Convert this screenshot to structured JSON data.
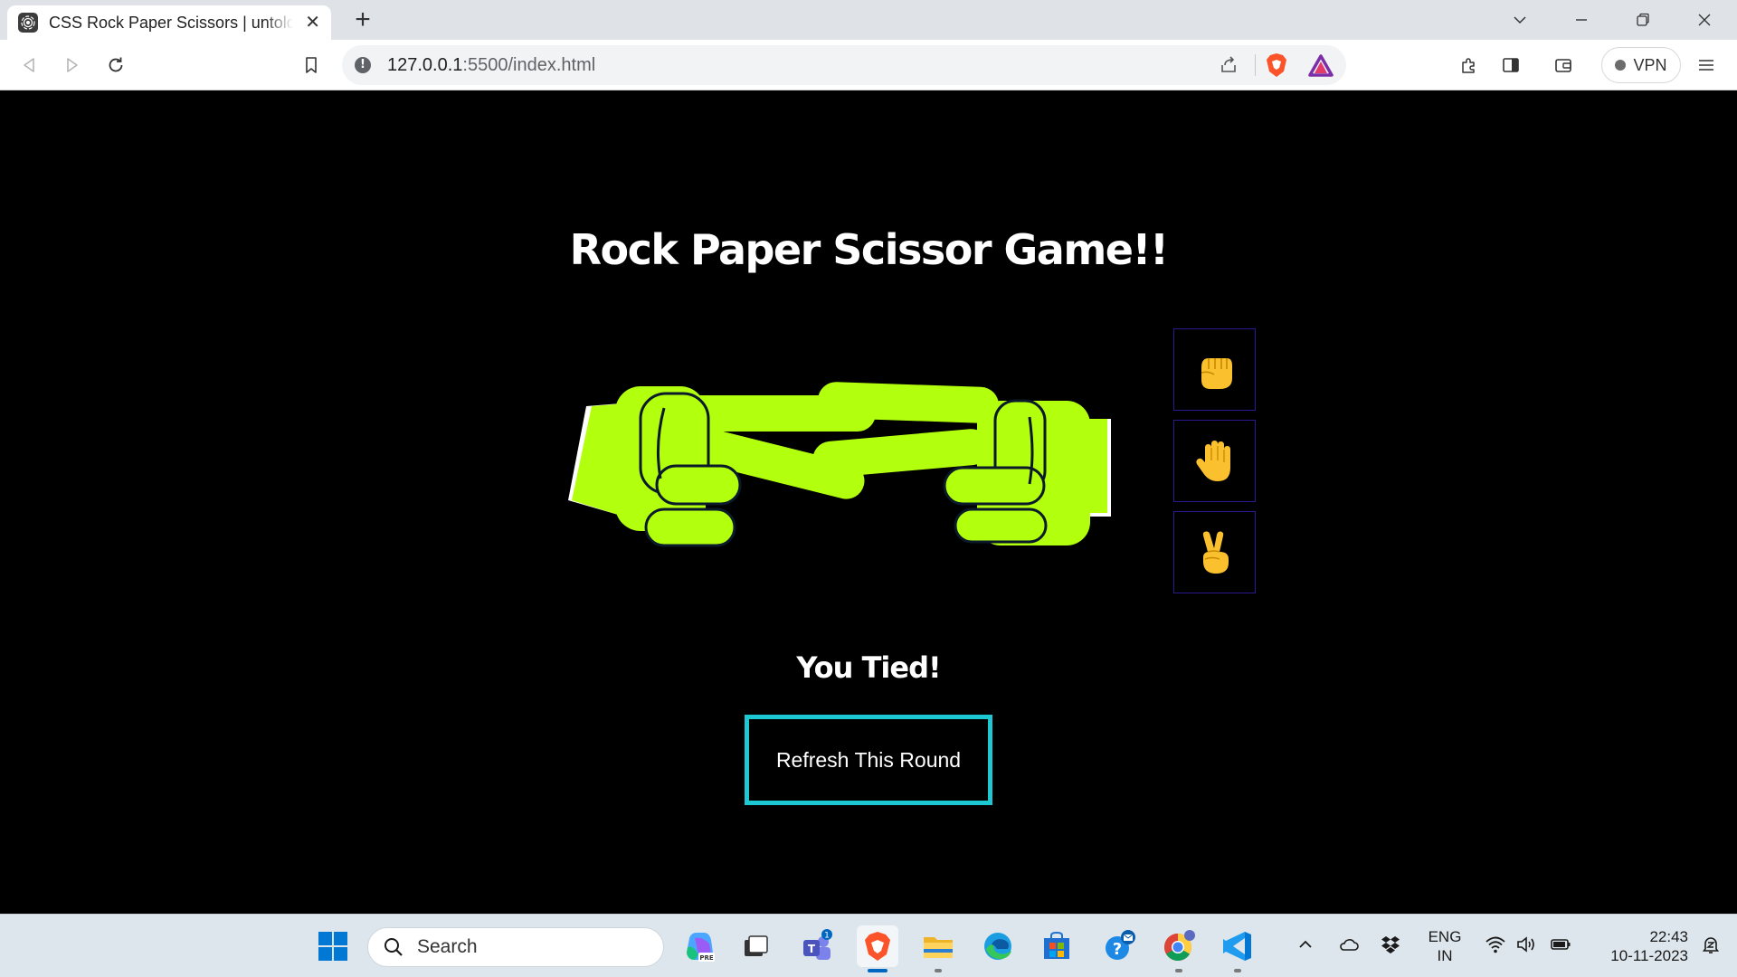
{
  "browser": {
    "tab_title": "CSS Rock Paper Scissors | untold",
    "url_host": "127.0.0.1",
    "url_rest": ":5500/index.html",
    "vpn_label": "VPN"
  },
  "game": {
    "title": "Rock Paper Scissor Game!!",
    "result": "You Tied!",
    "refresh_label": "Refresh This Round",
    "choices": [
      "rock",
      "paper",
      "scissors"
    ],
    "player_hand": "scissors",
    "computer_hand": "scissors",
    "colors": {
      "hand": "#b2ff0e",
      "button_border": "#1ec8d3",
      "choice_border": "#2a1a8f",
      "emoji": "#fbc02d"
    }
  },
  "taskbar": {
    "search_label": "Search",
    "teams_badge": "1",
    "copilot_badge": "PRE",
    "language": "ENG",
    "region": "IN",
    "time": "22:43",
    "date": "10-11-2023"
  }
}
